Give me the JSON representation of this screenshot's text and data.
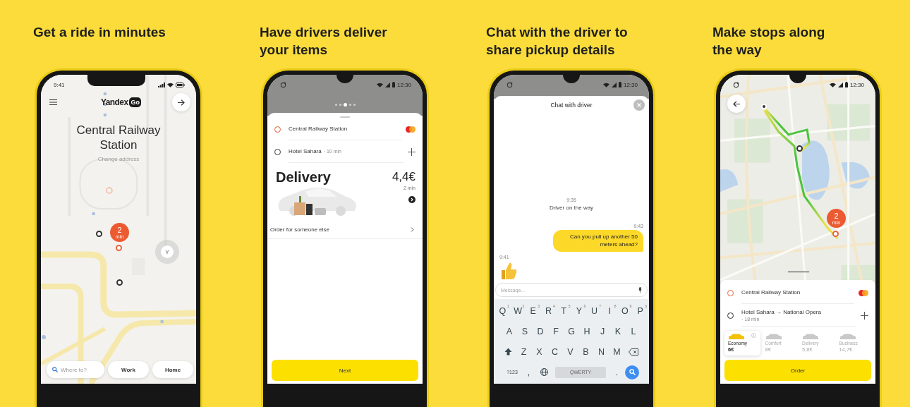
{
  "panels": [
    {
      "kind": "ride",
      "caption": "Get a ride in minutes",
      "status_time": "9:41",
      "logo_text": "Yandex",
      "logo_badge": "Go",
      "address": "Central Railway Station",
      "change_address": "Change address",
      "eta_value": "2",
      "eta_unit": "min",
      "place_marker": "Y",
      "search_placeholder": "Where to?",
      "shortcuts": [
        "Work",
        "Home"
      ]
    },
    {
      "kind": "delivery",
      "caption": "Have drivers deliver\nyour items",
      "status_time": "12:30",
      "page_dots": [
        {
          "selected": false
        },
        {
          "selected": false
        },
        {
          "selected": true
        },
        {
          "selected": false
        },
        {
          "selected": false
        }
      ],
      "route": [
        {
          "kind": "pickup",
          "place": "Central Railway Station"
        },
        {
          "kind": "destination",
          "place": "Hotel Sahara",
          "note": "· 10 min"
        }
      ],
      "tariff": "Delivery",
      "price": "4,4€",
      "duration": "2 min",
      "order_other": "Order for someone else",
      "button": "Next"
    },
    {
      "kind": "chat",
      "caption": "Chat with the driver to\nshare pickup details",
      "status_time": "12:30",
      "title": "Chat with driver",
      "messages": [
        {
          "kind": "system",
          "time": "9:35",
          "text": "Driver on the way"
        },
        {
          "kind": "outgoing",
          "time": "9:43",
          "text": "Can you pull up another 50 meters ahead?"
        },
        {
          "kind": "sticker",
          "time": "9:41"
        }
      ],
      "input_placeholder": "Message...",
      "keyboard_rows": [
        [
          {
            "kind": "letter",
            "label": "Q",
            "hint": "1"
          },
          {
            "kind": "letter",
            "label": "W",
            "hint": "2"
          },
          {
            "kind": "letter",
            "label": "E",
            "hint": "3"
          },
          {
            "kind": "letter",
            "label": "R",
            "hint": "4"
          },
          {
            "kind": "letter",
            "label": "T",
            "hint": "5"
          },
          {
            "kind": "letter",
            "label": "Y",
            "hint": "6"
          },
          {
            "kind": "letter",
            "label": "U",
            "hint": "7"
          },
          {
            "kind": "letter",
            "label": "I",
            "hint": "8"
          },
          {
            "kind": "letter",
            "label": "O",
            "hint": "9"
          },
          {
            "kind": "letter",
            "label": "P",
            "hint": "0"
          }
        ],
        [
          {
            "kind": "letter",
            "label": "A"
          },
          {
            "kind": "letter",
            "label": "S"
          },
          {
            "kind": "letter",
            "label": "D"
          },
          {
            "kind": "letter",
            "label": "F"
          },
          {
            "kind": "letter",
            "label": "G"
          },
          {
            "kind": "letter",
            "label": "H"
          },
          {
            "kind": "letter",
            "label": "J"
          },
          {
            "kind": "letter",
            "label": "K"
          },
          {
            "kind": "letter",
            "label": "L"
          }
        ],
        [
          {
            "kind": "shift"
          },
          {
            "kind": "letter",
            "label": "Z"
          },
          {
            "kind": "letter",
            "label": "X"
          },
          {
            "kind": "letter",
            "label": "C"
          },
          {
            "kind": "letter",
            "label": "V"
          },
          {
            "kind": "letter",
            "label": "B"
          },
          {
            "kind": "letter",
            "label": "N"
          },
          {
            "kind": "letter",
            "label": "M"
          },
          {
            "kind": "backspace"
          }
        ],
        [
          {
            "kind": "mode",
            "label": "?123"
          },
          {
            "kind": "comma",
            "label": ","
          },
          {
            "kind": "globe"
          },
          {
            "kind": "space",
            "label": "QWERTY"
          },
          {
            "kind": "period",
            "label": "."
          },
          {
            "kind": "search"
          }
        ]
      ]
    },
    {
      "kind": "route",
      "caption": "Make stops along\nthe way",
      "status_time": "12:30",
      "eta_value": "2",
      "eta_unit": "min",
      "route": [
        {
          "kind": "pickup",
          "place": "Central Railway Station"
        },
        {
          "kind": "destination",
          "place": "Hotel Sahara → National Opera",
          "note": "· 18 min"
        }
      ],
      "tariffs": [
        {
          "name": "Economy",
          "price": "6€",
          "selected": true
        },
        {
          "name": "Comfort",
          "price": "8€",
          "selected": false
        },
        {
          "name": "Delivery",
          "price": "5,8€",
          "selected": false
        },
        {
          "name": "Business",
          "price": "14,7€",
          "selected": false
        }
      ],
      "button": "Order"
    }
  ]
}
